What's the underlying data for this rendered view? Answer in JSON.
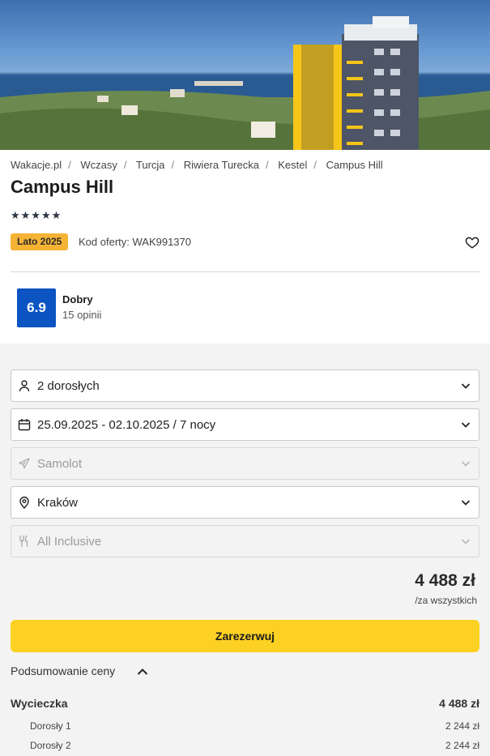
{
  "breadcrumbs": [
    "Wakacje.pl",
    "Wczasy",
    "Turcja",
    "Riwiera Turecka",
    "Kestel",
    "Campus Hill"
  ],
  "hotel": {
    "name": "Campus Hill",
    "stars_display": "★★★★★",
    "season_badge": "Lato 2025",
    "offer_code": "Kod oferty: WAK991370"
  },
  "rating": {
    "score": "6.9",
    "label": "Dobry",
    "count": "15 opinii"
  },
  "form": {
    "guests": "2 dorosłych",
    "dates": "25.09.2025 - 02.10.2025 / 7 nocy",
    "transport": "Samolot",
    "departure": "Kraków",
    "board": "All Inclusive"
  },
  "price": {
    "total": "4 488 zł",
    "note": "/za wszystkich"
  },
  "reserve_label": "Zarezerwuj",
  "summary": {
    "toggle_label": "Podsumowanie ceny",
    "trip_label": "Wycieczka",
    "trip_total": "4 488 zł",
    "lines": [
      {
        "label": "Dorosły 1",
        "value": "2 244 zł"
      },
      {
        "label": "Dorosły 2",
        "value": "2 244 zł"
      }
    ]
  },
  "colors": {
    "accent_blue": "#0b54c2",
    "reserve_yellow": "#fdd123",
    "badge_orange": "#f5b335"
  },
  "icons": [
    "hero-photo",
    "heart-icon",
    "person-icon",
    "calendar-icon",
    "plane-icon",
    "location-pin-icon",
    "fork-knife-icon",
    "chevron-down-icon",
    "chevron-up-icon"
  ]
}
